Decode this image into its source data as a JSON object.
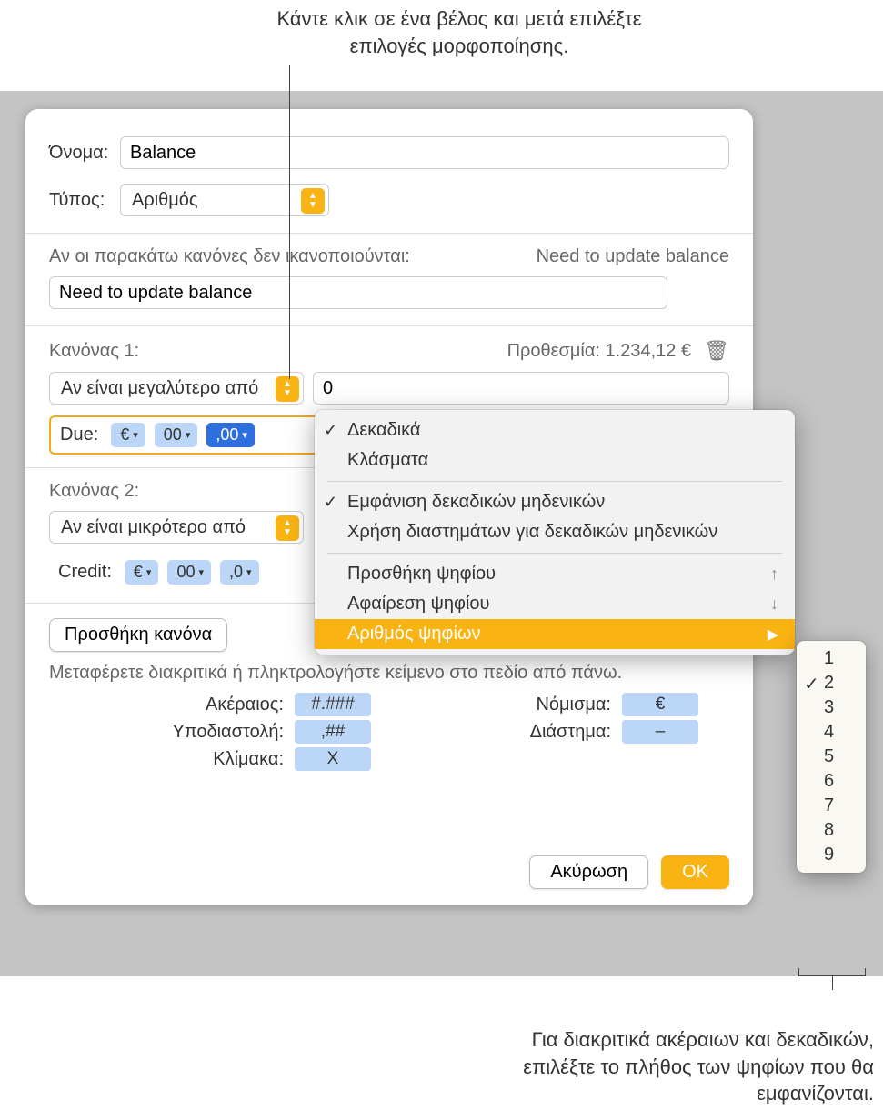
{
  "callout_top": "Κάντε κλικ σε ένα βέλος και μετά επιλέξτε επιλογές μορφοποίησης.",
  "callout_bottom": "Για διακριτικά ακέραιων και δεκαδικών, επιλέξτε το πλήθος των ψηφίων που θα εμφανίζονται.",
  "nameLabel": "Όνομα:",
  "nameValue": "Balance",
  "typeLabel": "Τύπος:",
  "typeValue": "Αριθμός",
  "noRulesLabel": "Αν οι παρακάτω κανόνες δεν ικανοποιούνται:",
  "noRulesPreview": "Need to update balance",
  "noRulesValue": "Need to update balance",
  "rule1": {
    "label": "Κανόνας 1:",
    "preview": "Προθεσμία: 1.234,12 €",
    "condition": "Αν είναι μεγαλύτερο από",
    "value": "0",
    "prefix": "Due:",
    "tokens": [
      "€",
      "00",
      ",00"
    ]
  },
  "rule2": {
    "label": "Κανόνας 2:",
    "condition": "Αν είναι μικρότερο από",
    "prefix": "Credit:",
    "tokens": [
      "€",
      "00",
      ",0"
    ]
  },
  "addRuleBtn": "Προσθήκη κανόνα",
  "hintText": "Μεταφέρετε διακριτικά ή πληκτρολογήστε κείμενο στο πεδίο από πάνω.",
  "kv": {
    "integerK": "Ακέραιος:",
    "integerV": "#.###",
    "decimalK": "Υποδιαστολή:",
    "decimalV": ",##",
    "scaleK": "Κλίμακα:",
    "scaleV": "X",
    "currencyK": "Νόμισμα:",
    "currencyV": "€",
    "spaceK": "Διάστημα:",
    "spaceV": "–"
  },
  "cancelBtn": "Ακύρωση",
  "okBtn": "OK",
  "popup": {
    "decimals": "Δεκαδικά",
    "fractions": "Κλάσματα",
    "showZeros": "Εμφάνιση δεκαδικών μηδενικών",
    "spaceZeros": "Χρήση διαστημάτων για δεκαδικών μηδενικών",
    "addDigit": "Προσθήκη ψηφίου",
    "addDigitKey": "↑",
    "removeDigit": "Αφαίρεση ψηφίου",
    "removeDigitKey": "↓",
    "digitCount": "Αριθμός ψηφίων"
  },
  "digits": [
    "1",
    "2",
    "3",
    "4",
    "5",
    "6",
    "7",
    "8",
    "9"
  ],
  "digitsSelectedIndex": 1
}
